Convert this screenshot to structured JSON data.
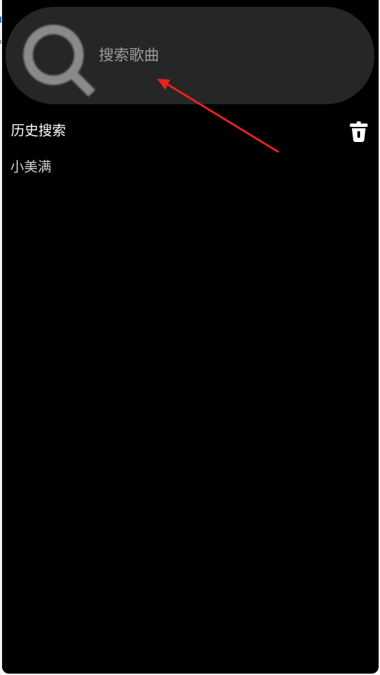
{
  "search": {
    "placeholder": "搜索歌曲",
    "value": "",
    "icon": "search-icon"
  },
  "history": {
    "title": "历史搜索",
    "clear_icon": "trash-icon",
    "items": [
      {
        "label": "小美满"
      }
    ]
  },
  "colors": {
    "background": "#000000",
    "search_bar": "#262626",
    "icon_gray": "#8a8a8a",
    "placeholder": "#9b9b9b",
    "annotation_arrow": "#e8231f"
  }
}
